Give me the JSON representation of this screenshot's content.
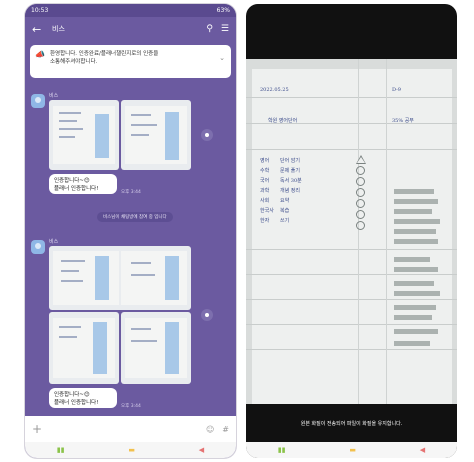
{
  "left": {
    "statusbar": {
      "time": "10:53",
      "right": "63%"
    },
    "header": {
      "title": "비스",
      "back_icon": "back-arrow-icon",
      "search_icon": "search-icon",
      "menu_icon": "menu-icon"
    },
    "notice": {
      "line1": "환영합니다. 인증완료/플래너챌린지로의 인증을",
      "line2": "소통해주셔야합니다.",
      "icon": "megaphone-icon"
    },
    "messages": [
      {
        "sender": "비스",
        "text_line1": "인증합니다~😊",
        "text_line2": "플래너 인증합니다!",
        "time": "오후 3:44"
      },
      {
        "sender": "비스",
        "text_line1": "인증합니다~😊",
        "text_line2": "플래너 인증합니다!",
        "time": "오후 3:44"
      }
    ],
    "system_message": "비스님이 채팅방에 참여 중 입니다",
    "input": {
      "placeholder": ""
    },
    "colors": {
      "background": "#6b5aa0",
      "bubble": "#ffffff"
    }
  },
  "right": {
    "notebook": {
      "date": "2022.05.25",
      "page_no": "D-9",
      "subtitle": "학원 영어단어",
      "right_note": "35% 공부",
      "subjects": [
        "영어",
        "수학",
        "국어",
        "과학",
        "사회",
        "한국사",
        "한자"
      ],
      "tasks": [
        "단어 암기",
        "문제 풀기",
        "독서 30분",
        "개념 정리",
        "요약",
        "복습",
        "쓰기"
      ]
    },
    "caption": "원본 화질이 전송되어 파일이 화질을 유지합니다."
  }
}
